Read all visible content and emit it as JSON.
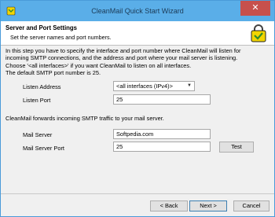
{
  "window": {
    "title": "CleanMail Quick Start Wizard",
    "close_glyph": "✕"
  },
  "header": {
    "title": "Server and Port Settings",
    "subtitle": "Set the server names and port numbers."
  },
  "intro": {
    "line1": "In this step you have to specify the interface and port number where CleanMail will listen for",
    "line2": "incoming SMTP connections, and the address and port where your mail server is listening.",
    "line3": "Choose '<all interfaces>' if you want CleanMail to listen on all interfaces.",
    "line4": "The default SMTP port number is 25."
  },
  "listen": {
    "address_label": "Listen Address",
    "address_value": "<all interfaces (IPv4)>",
    "port_label": "Listen Port",
    "port_value": "25"
  },
  "forward_note": "CleanMail forwards incoming SMTP traffic to your mail server.",
  "mail": {
    "server_label": "Mail Server",
    "server_value": "Softpedia.com",
    "port_label": "Mail Server Port",
    "port_value": "25",
    "test_label": "Test"
  },
  "footer": {
    "back_label": "< Back",
    "next_label": "Next >",
    "cancel_label": "Cancel"
  },
  "colors": {
    "titlebar": "#5aaee8",
    "close": "#c7504c",
    "icon_yellow": "#f2d500",
    "icon_green": "#2e8b2e"
  }
}
